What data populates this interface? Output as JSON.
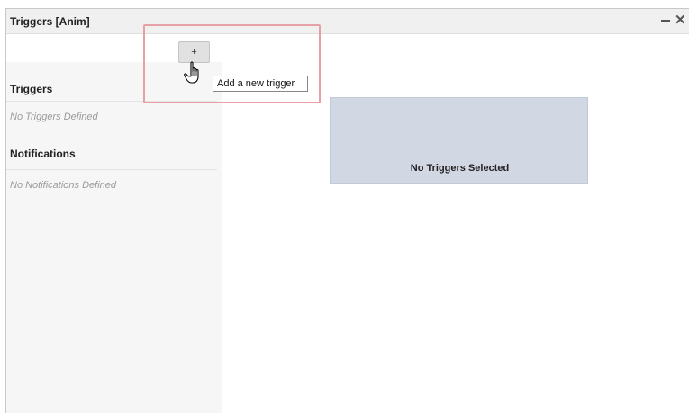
{
  "window": {
    "title": "Triggers [Anim]"
  },
  "toolbar": {
    "add_button_label": "+",
    "add_tooltip": "Add a new trigger"
  },
  "sidebar": {
    "triggers_heading": "Triggers",
    "triggers_empty": "No Triggers Defined",
    "notifications_heading": "Notifications",
    "notifications_empty": "No Notifications Defined"
  },
  "main": {
    "empty_message": "No Triggers Selected"
  },
  "colors": {
    "highlight": "#e7a1a6",
    "empty_box": "#d1d7e3"
  },
  "icons": [
    "minimize-icon",
    "close-icon",
    "hand-cursor-icon"
  ]
}
